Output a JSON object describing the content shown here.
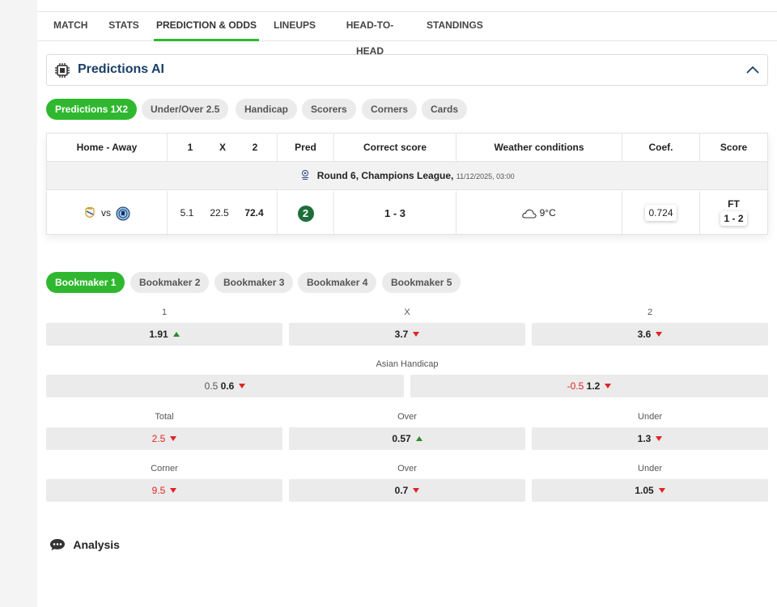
{
  "tabs": [
    "MATCH",
    "STATS",
    "PREDICTION & ODDS",
    "LINEUPS",
    "HEAD-TO-HEAD",
    "STANDINGS"
  ],
  "active_tab": "PREDICTION & ODDS",
  "predictions": {
    "title": "Predictions AI",
    "pills": [
      "Predictions 1X2",
      "Under/Over 2.5",
      "Handicap",
      "Scorers",
      "Corners",
      "Cards"
    ],
    "headers": {
      "home_away": "Home - Away",
      "h1": "1",
      "hx": "X",
      "h2": "2",
      "pred": "Pred",
      "correct_score": "Correct score",
      "weather": "Weather conditions",
      "coef": "Coef.",
      "score": "Score"
    },
    "round": {
      "title": "Round 6, Champions League,",
      "meta": "11/12/2025, 03:00"
    },
    "row": {
      "vs": "vs",
      "p1": "5.1",
      "px": "22.5",
      "p2": "72.4",
      "pred": "2",
      "correct_score": "1 - 3",
      "weather": "9°C",
      "coef": "0.724",
      "status": "FT",
      "score": "1 - 2"
    }
  },
  "bookmakers": [
    "Bookmaker 1",
    "Bookmaker 2",
    "Bookmaker 3",
    "Bookmaker 4",
    "Bookmaker 5"
  ],
  "odds": {
    "labels_1x2": [
      "1",
      "X",
      "2"
    ],
    "values_1x2": [
      "1.91",
      "3.7",
      "3.6"
    ],
    "asian_handicap_label": "Asian Handicap",
    "ah_home_line": "0.5",
    "ah_home_value": "0.6",
    "ah_away_line": "-0.5",
    "ah_away_value": "1.2",
    "total_labels": [
      "Total",
      "Over",
      "Under"
    ],
    "total_line": "2.5",
    "total_over": "0.57",
    "total_under": "1.3",
    "corner_labels": [
      "Corner",
      "Over",
      "Under"
    ],
    "corner_line": "9.5",
    "corner_over": "0.7",
    "corner_under": "1.05"
  },
  "analysis_title": "Analysis",
  "colors": {
    "accent_green": "#2fb82f",
    "title_navy": "#1a3f66",
    "arrow_up": "#2a8a2a",
    "arrow_down": "#e02424"
  }
}
